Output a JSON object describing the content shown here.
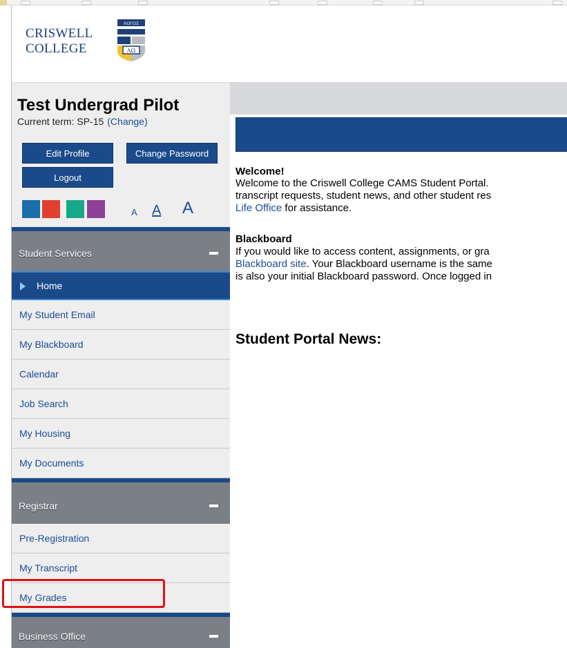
{
  "logo": {
    "line1": "CRISWELL",
    "line2": "COLLEGE",
    "shield_text": "ΛΟΓΟΣ"
  },
  "student": {
    "name": "Test Undergrad Pilot",
    "term_prefix": "Current term: SP-15",
    "change_link": "(Change)"
  },
  "buttons": {
    "edit_profile": "Edit Profile",
    "change_password": "Change Password",
    "logout": "Logout"
  },
  "themes": [
    "#1a6fa8",
    "#e0402f",
    "#16a987",
    "#8e3f96"
  ],
  "font_size": {
    "small": "A",
    "medium": "A",
    "large": "A"
  },
  "nav": {
    "student_services": {
      "title": "Student Services",
      "items": [
        "Home",
        "My Student Email",
        "My Blackboard",
        "Calendar",
        "Job Search",
        "My Housing",
        "My Documents"
      ]
    },
    "registrar": {
      "title": "Registrar",
      "items": [
        "Pre-Registration",
        "My Transcript",
        "My Grades"
      ]
    },
    "business_office": {
      "title": "Business Office"
    }
  },
  "content": {
    "welcome_heading": "Welcome!",
    "welcome_line1": "Welcome to the Criswell College CAMS Student Portal.",
    "welcome_line2": "transcript requests, student news, and other student res",
    "welcome_link": "Life Office",
    "welcome_line3_rest": " for assistance.",
    "blackboard_heading": "Blackboard",
    "bb_line1": "If you would like to access content, assignments, or gra",
    "bb_link": "Blackboard site",
    "bb_line2_rest": ". Your Blackboard username is the same",
    "bb_line3": "is also your initial Blackboard password. Once logged in",
    "news_heading": "Student Portal News:"
  }
}
